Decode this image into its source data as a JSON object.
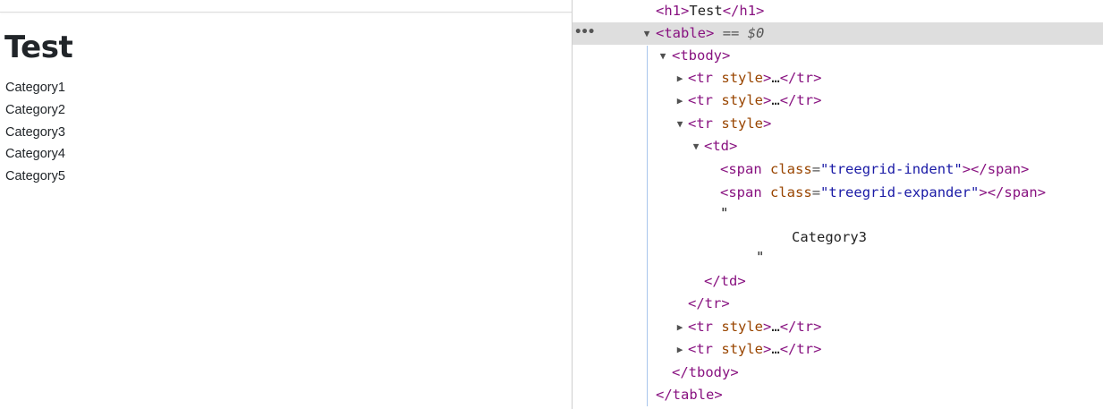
{
  "page": {
    "title": "Test",
    "categories": [
      "Category1",
      "Category2",
      "Category3",
      "Category4",
      "Category5"
    ]
  },
  "devtools": {
    "h1_tag": "h1",
    "h1_text": "Test",
    "table_tag": "table",
    "selected_marker": "== $0",
    "tbody_tag": "tbody",
    "tr_tag": "tr",
    "style_attr": "style",
    "collapsed_ellipsis": "…",
    "td_tag": "td",
    "span_tag": "span",
    "class_attr": "class",
    "indent_class": "treegrid-indent",
    "expander_class": "treegrid-expander",
    "quote": "\"",
    "text_node": "Category3",
    "ellipsis_button": "•••",
    "collapse_arrow": "▼",
    "expand_arrow": "▶"
  },
  "colors": {
    "tag": "#881280",
    "attr_name": "#994500",
    "attr_value": "#1a1aa6",
    "selected_row": "#dedede",
    "guide": "#a9c6ec"
  }
}
